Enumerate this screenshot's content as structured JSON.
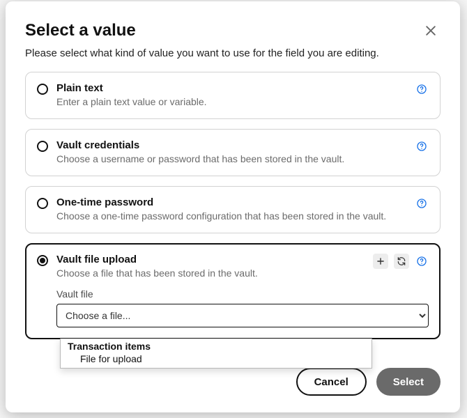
{
  "dialog": {
    "title": "Select a value",
    "subtitle": "Please select what kind of value you want to use for the field you are editing."
  },
  "options": {
    "plain": {
      "title": "Plain text",
      "desc": "Enter a plain text value or variable."
    },
    "vaultcred": {
      "title": "Vault credentials",
      "desc": "Choose a username or password that has been stored in the vault."
    },
    "otp": {
      "title": "One-time password",
      "desc": "Choose a one-time password configuration that has been stored in the vault."
    },
    "fileupload": {
      "title": "Vault file upload",
      "desc": "Choose a file that has been stored in the vault.",
      "field_label": "Vault file",
      "placeholder": "Choose a file..."
    }
  },
  "dropdown": {
    "group": "Transaction items",
    "item": "File for upload"
  },
  "footer": {
    "cancel": "Cancel",
    "select": "Select"
  }
}
